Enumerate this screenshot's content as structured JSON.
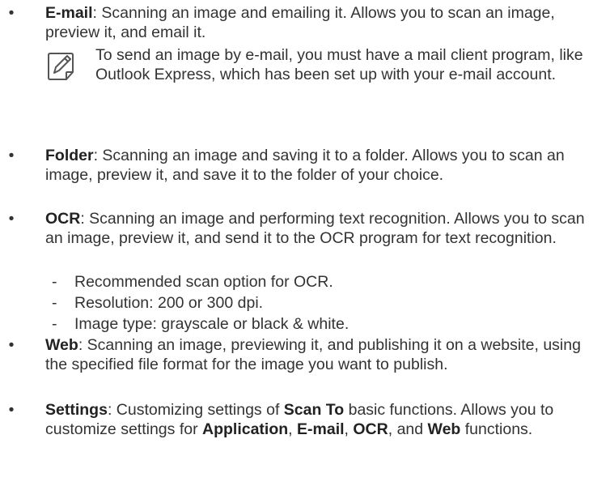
{
  "items": [
    {
      "bullet": "•",
      "term": "E-mail",
      "text": ": Scanning an image and emailing it. Allows you to scan an image, preview it, and email it."
    },
    {
      "bullet": "•",
      "term": "Folder",
      "text": ": Scanning an image and saving it to a folder. Allows you to scan an image, preview it, and save it to the folder of your choice."
    },
    {
      "bullet": "•",
      "term": "OCR",
      "text": ": Scanning an image and performing text recognition. Allows you to scan an image, preview it, and send it to the OCR program for text recognition."
    },
    {
      "bullet": "•",
      "term": "Web",
      "text": ": Scanning an image, previewing it, and publishing it on a website, using the specified file format for the image you want to publish."
    },
    {
      "bullet": "•",
      "term": "Settings",
      "text_a": ": Customizing settings of ",
      "term_b": "Scan To",
      "text_b": " basic functions. Allows you to customize settings for ",
      "term_c": "Application",
      "text_c": ", ",
      "term_d": "E-mail",
      "text_d": ", ",
      "term_e": "OCR",
      "text_e": ", and ",
      "term_f": "Web",
      "text_f": " functions."
    }
  ],
  "note": {
    "icon": "note-pencil-icon",
    "text": "To send an image by e-mail, you must have a mail client program, like Outlook Express, which has been set up with your e-mail account."
  },
  "ocr_subitems": [
    {
      "dash": "-",
      "text": "Recommended scan option for OCR."
    },
    {
      "dash": "-",
      "text": "Resolution: 200 or 300 dpi."
    },
    {
      "dash": "-",
      "text": "Image type: grayscale or black & white."
    }
  ]
}
